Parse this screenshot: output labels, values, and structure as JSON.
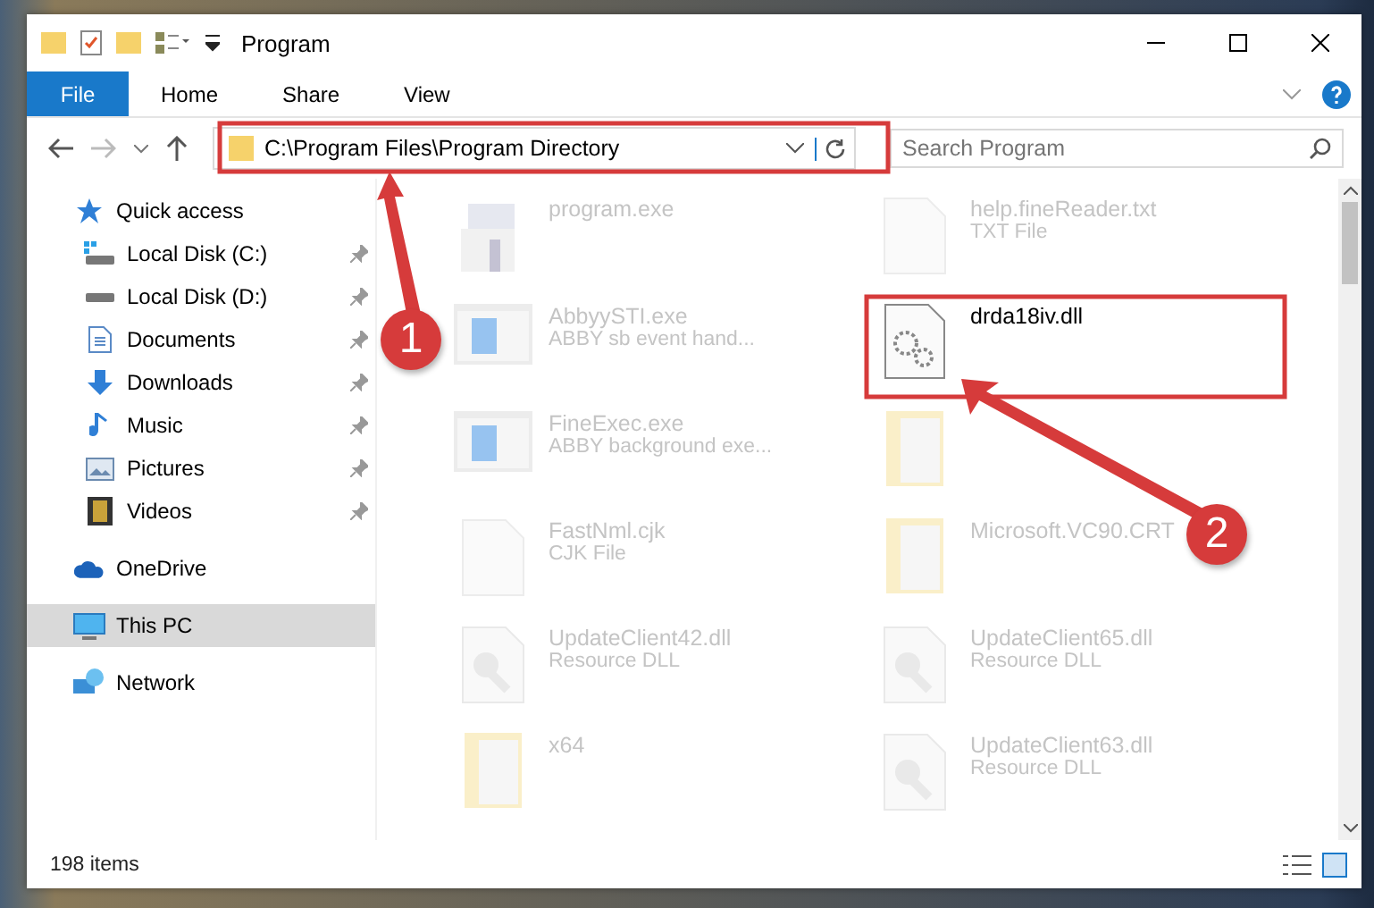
{
  "window": {
    "title": "Program"
  },
  "ribbon": {
    "file_button": "File",
    "tabs": [
      "Home",
      "Share",
      "View"
    ]
  },
  "address_bar": {
    "path": "C:\\Program Files\\Program Directory",
    "search_placeholder": "Search Program"
  },
  "sidebar": {
    "items": [
      {
        "label": "Quick access",
        "kind": "star",
        "selected": false,
        "children": [
          {
            "label": "Local Disk (C:)",
            "kind": "drive-c",
            "pinned": true,
            "selected": false
          },
          {
            "label": "Local Disk (D:)",
            "kind": "drive",
            "pinned": true,
            "selected": false
          },
          {
            "label": "Documents",
            "kind": "document",
            "pinned": true,
            "selected": false
          },
          {
            "label": "Downloads",
            "kind": "download",
            "pinned": true,
            "selected": false
          },
          {
            "label": "Music",
            "kind": "music",
            "pinned": true,
            "selected": false
          },
          {
            "label": "Pictures",
            "kind": "picture",
            "pinned": true,
            "selected": false
          },
          {
            "label": "Videos",
            "kind": "video",
            "pinned": true,
            "selected": false
          }
        ]
      },
      {
        "label": "OneDrive",
        "kind": "cloud",
        "selected": false
      },
      {
        "label": "This PC",
        "kind": "pc",
        "selected": true
      },
      {
        "label": "Network",
        "kind": "network",
        "selected": false
      }
    ]
  },
  "files": [
    {
      "name": "program.exe",
      "kind": "installer",
      "faded": true
    },
    {
      "name": "help.fineReader.txt",
      "type": "TXT File",
      "kind": "blank",
      "faded": true
    },
    {
      "name": "AbbyySTI.exe",
      "type": "ABBY sb event hand...",
      "kind": "app",
      "faded": true
    },
    {
      "name": "drda18iv.dll",
      "kind": "gear",
      "faded": false
    },
    {
      "name": "FineExec.exe",
      "type": "ABBY background exe...",
      "kind": "app",
      "faded": true
    },
    {
      "kind": "folder",
      "faded": true
    },
    {
      "name": "FastNml.cjk",
      "type": "CJK File",
      "kind": "blank",
      "faded": true
    },
    {
      "name": "Microsoft.VC90.CRT",
      "kind": "folder",
      "faded": true
    },
    {
      "name": "UpdateClient42.dll",
      "type": "Resource DLL",
      "kind": "dll",
      "faded": true
    },
    {
      "name": "UpdateClient65.dll",
      "type": "Resource DLL",
      "kind": "dll",
      "faded": true
    },
    {
      "name": "x64",
      "kind": "folder",
      "faded": true
    },
    {
      "name": "UpdateClient63.dll",
      "type": "Resource DLL",
      "kind": "dll",
      "faded": true
    }
  ],
  "status_bar": {
    "item_count": "198 items"
  },
  "annotations": [
    {
      "label": "1"
    },
    {
      "label": "2"
    }
  ]
}
